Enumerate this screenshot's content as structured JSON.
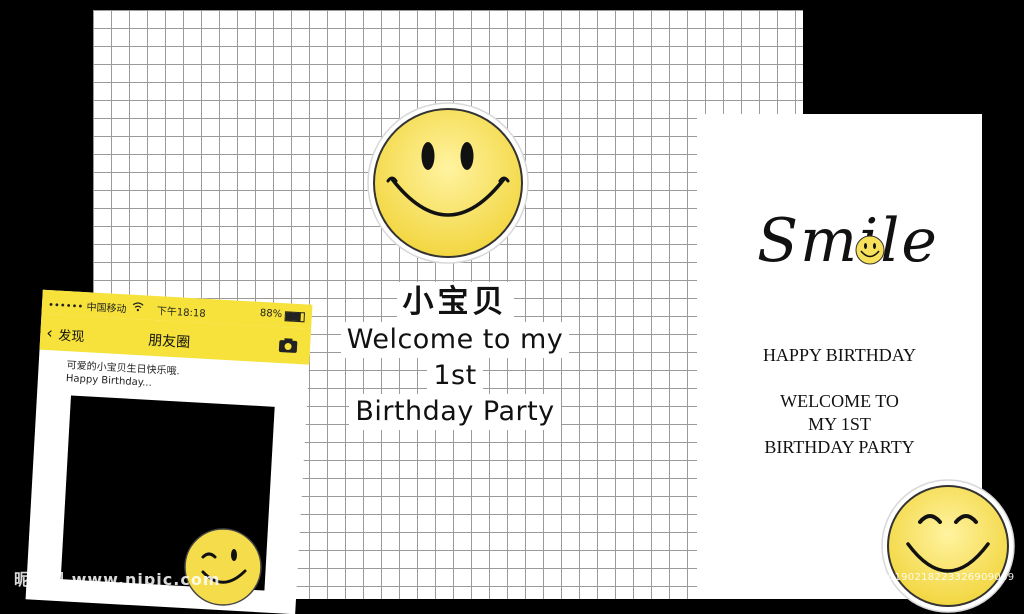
{
  "hero": {
    "cn_title": "小宝贝",
    "line1": "Welcome to my",
    "line2": "1st",
    "line3": "Birthday Party"
  },
  "card": {
    "script_title": "Smile",
    "happy": "HAPPY BIRTHDAY",
    "welcome1": "WELCOME TO",
    "welcome2": "MY 1ST",
    "welcome3": "BIRTHDAY PARTY"
  },
  "phone": {
    "carrier": "•••••• 中国移动",
    "time": "下午18:18",
    "battery": "88%",
    "back_label": "发现",
    "title": "朋友圈",
    "post_line1": "可爱的小宝贝生日快乐哦.",
    "post_line2": "Happy Birthday..."
  },
  "watermark": {
    "left": "昵图网 www.nipic.com",
    "right": "ID:27070328 NO:20190218223326909089"
  },
  "colors": {
    "smiley_yellow": "#f7e15a",
    "phone_yellow": "#f6e23a",
    "background": "#000000"
  },
  "icons": [
    "smiley-face-icon",
    "winking-smiley-icon",
    "laughing-smiley-icon",
    "camera-icon",
    "wifi-icon",
    "back-chevron-icon"
  ]
}
